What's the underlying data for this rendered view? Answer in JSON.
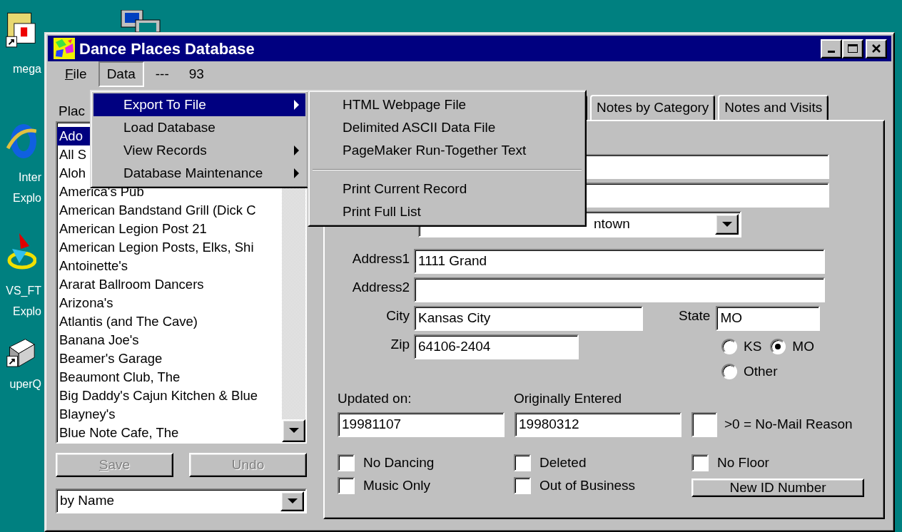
{
  "desktop_icons": [
    {
      "kind": "folder",
      "label_lines": [
        "mega"
      ]
    },
    {
      "kind": "computer"
    },
    {
      "kind": "browser",
      "label_lines": [
        "Inter",
        "Explo"
      ]
    },
    {
      "kind": "satellite",
      "label_lines": [
        "VS_FT",
        "Explo"
      ]
    },
    {
      "kind": "printer",
      "label_lines": [
        "uperQ"
      ]
    }
  ],
  "window": {
    "title": "Dance Places Database"
  },
  "menu_bar": [
    {
      "kind": "menu",
      "label": "File",
      "mnemonic": true,
      "selected": false
    },
    {
      "kind": "menu",
      "label": "Data",
      "mnemonic": false,
      "selected": true
    },
    {
      "kind": "text",
      "label": "---"
    },
    {
      "kind": "text",
      "label": "93"
    }
  ],
  "list_label": "Plac",
  "places": [
    {
      "name": "Ado",
      "selected": true
    },
    {
      "name": "All S",
      "selected": false
    },
    {
      "name": "Aloh",
      "selected": false
    },
    {
      "name": "America's Pub",
      "selected": false
    },
    {
      "name": "American Bandstand Grill (Dick C",
      "selected": false
    },
    {
      "name": "American Legion Post 21",
      "selected": false
    },
    {
      "name": "American Legion Posts, Elks, Shi",
      "selected": false
    },
    {
      "name": "Antoinette's",
      "selected": false
    },
    {
      "name": "Ararat Ballroom Dancers",
      "selected": false
    },
    {
      "name": "Arizona's",
      "selected": false
    },
    {
      "name": "Atlantis (and The Cave)",
      "selected": false
    },
    {
      "name": "Banana Joe's",
      "selected": false
    },
    {
      "name": "Beamer's Garage",
      "selected": false
    },
    {
      "name": "Beaumont Club, The",
      "selected": false
    },
    {
      "name": "Big Daddy's Cajun Kitchen & Blue",
      "selected": false
    },
    {
      "name": "Blayney's",
      "selected": false
    },
    {
      "name": "Blue Note Cafe, The",
      "selected": false
    }
  ],
  "buttons": [
    {
      "label": "Save",
      "mnemonic": true,
      "disabled": true
    },
    {
      "label": "Undo",
      "mnemonic": false,
      "disabled": true
    }
  ],
  "sort_combo": {
    "value": "by Name"
  },
  "tabs": [
    {
      "label": "Notes by Category",
      "selected": false
    },
    {
      "label": "Notes and Visits",
      "selected": false
    }
  ],
  "area_combo": {
    "value": "ntown"
  },
  "address": [
    {
      "label": "Address1",
      "value": "1111 Grand"
    },
    {
      "label": "Address2"
    }
  ],
  "city": {
    "label": "City",
    "value": "Kansas City"
  },
  "state": {
    "label": "State",
    "value": "MO"
  },
  "zip": {
    "label": "Zip",
    "value": "64106-2404"
  },
  "state_options": [
    {
      "label": "KS",
      "selected": false
    },
    {
      "label": "MO",
      "selected": true
    },
    {
      "label": "Other",
      "selected": false
    }
  ],
  "dates": [
    {
      "label": "Updated on:",
      "value": "19981107"
    },
    {
      "label": "Originally Entered",
      "value": "19980312"
    }
  ],
  "no_mail": {
    "label": ">0 = No-Mail Reason"
  },
  "flags": [
    {
      "label": "No Dancing",
      "checked": false
    },
    {
      "label": "Music Only",
      "checked": false
    },
    {
      "label": "Deleted",
      "checked": false
    },
    {
      "label": "Out of Business",
      "checked": false
    },
    {
      "label": "No Floor",
      "checked": false
    }
  ],
  "new_id_button": "New ID Number",
  "data_menu": [
    {
      "label": "Export To File",
      "selected": true,
      "submenu": true
    },
    {
      "label": "Load Database",
      "selected": false,
      "submenu": false
    },
    {
      "label": "View Records",
      "selected": false,
      "submenu": true
    },
    {
      "label": "Database Maintenance",
      "selected": false,
      "submenu": true
    }
  ],
  "export_menu": [
    {
      "kind": "item",
      "label": "HTML Webpage File"
    },
    {
      "kind": "item",
      "label": "Delimited ASCII Data File"
    },
    {
      "kind": "item",
      "label": "PageMaker Run-Together Text"
    },
    {
      "kind": "separator"
    },
    {
      "kind": "item",
      "label": "Print Current Record"
    },
    {
      "kind": "item",
      "label": "Print Full List"
    }
  ]
}
